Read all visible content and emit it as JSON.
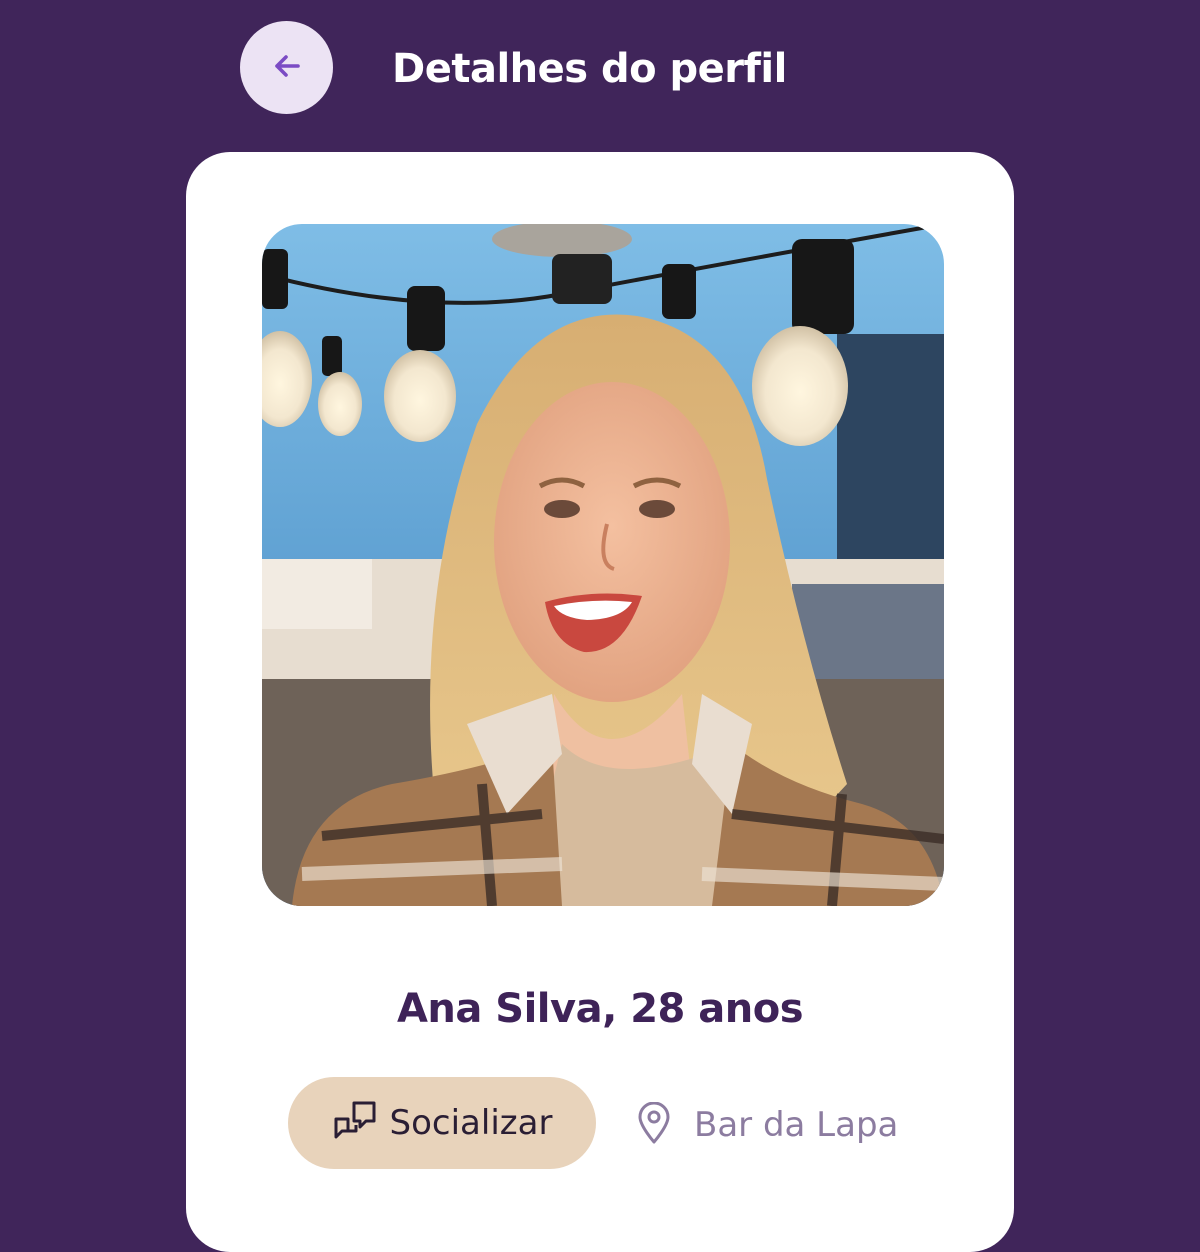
{
  "header": {
    "back_icon": "arrow-left-icon",
    "title": "Detalhes do perfil"
  },
  "colors": {
    "background": "#40255a",
    "back_button": "#ece3f4",
    "accent": "#7b4bc4",
    "card": "#ffffff",
    "name_text": "#3e2358",
    "chip": "#e8d3bb",
    "muted": "#8c7ca0"
  },
  "profile": {
    "photo_icon": "profile-photo",
    "name_age": "Ana Silva, 28 anos",
    "status": {
      "icon": "chat-bubbles-icon",
      "label": "Socializar"
    },
    "location": {
      "icon": "map-pin-icon",
      "label": "Bar da Lapa"
    }
  }
}
